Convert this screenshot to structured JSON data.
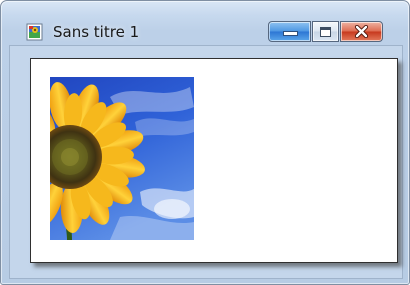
{
  "window": {
    "title": "Sans titre 1",
    "app_icon": "paint-canvas-icon",
    "buttons": {
      "minimize": "minimize-icon",
      "maximize": "maximize-icon",
      "close": "close-icon"
    }
  },
  "document": {
    "image": {
      "subject": "sunflower-photo"
    }
  },
  "colors": {
    "frame": "#bcd0e8",
    "client": "#c4d6eb",
    "canvas": "#ffffff",
    "close_button": "#c7391e",
    "minimize_button": "#2d76d4"
  }
}
